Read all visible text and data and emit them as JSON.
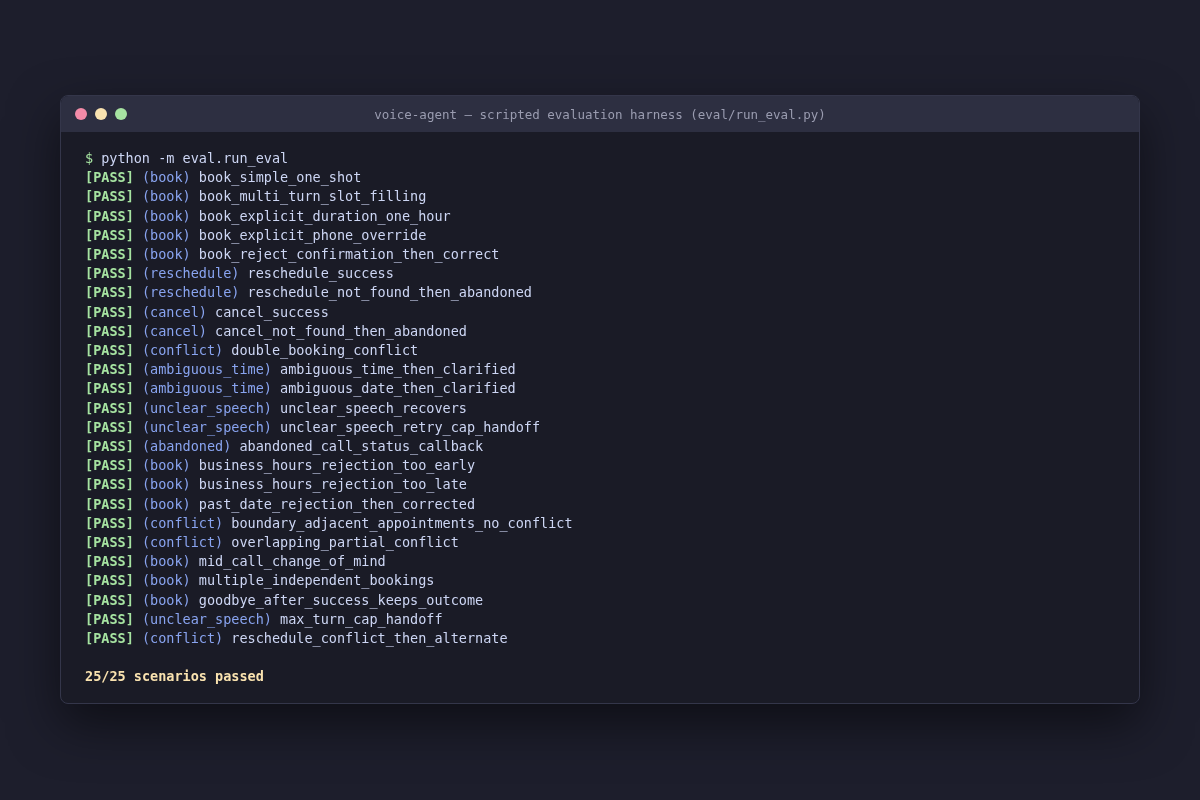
{
  "window": {
    "title": "voice-agent — scripted evaluation harness (eval/run_eval.py)"
  },
  "command": {
    "prompt": "$",
    "text": "python -m eval.run_eval"
  },
  "results": [
    {
      "status": "[PASS]",
      "category": "(book)",
      "name": "book_simple_one_shot"
    },
    {
      "status": "[PASS]",
      "category": "(book)",
      "name": "book_multi_turn_slot_filling"
    },
    {
      "status": "[PASS]",
      "category": "(book)",
      "name": "book_explicit_duration_one_hour"
    },
    {
      "status": "[PASS]",
      "category": "(book)",
      "name": "book_explicit_phone_override"
    },
    {
      "status": "[PASS]",
      "category": "(book)",
      "name": "book_reject_confirmation_then_correct"
    },
    {
      "status": "[PASS]",
      "category": "(reschedule)",
      "name": "reschedule_success"
    },
    {
      "status": "[PASS]",
      "category": "(reschedule)",
      "name": "reschedule_not_found_then_abandoned"
    },
    {
      "status": "[PASS]",
      "category": "(cancel)",
      "name": "cancel_success"
    },
    {
      "status": "[PASS]",
      "category": "(cancel)",
      "name": "cancel_not_found_then_abandoned"
    },
    {
      "status": "[PASS]",
      "category": "(conflict)",
      "name": "double_booking_conflict"
    },
    {
      "status": "[PASS]",
      "category": "(ambiguous_time)",
      "name": "ambiguous_time_then_clarified"
    },
    {
      "status": "[PASS]",
      "category": "(ambiguous_time)",
      "name": "ambiguous_date_then_clarified"
    },
    {
      "status": "[PASS]",
      "category": "(unclear_speech)",
      "name": "unclear_speech_recovers"
    },
    {
      "status": "[PASS]",
      "category": "(unclear_speech)",
      "name": "unclear_speech_retry_cap_handoff"
    },
    {
      "status": "[PASS]",
      "category": "(abandoned)",
      "name": "abandoned_call_status_callback"
    },
    {
      "status": "[PASS]",
      "category": "(book)",
      "name": "business_hours_rejection_too_early"
    },
    {
      "status": "[PASS]",
      "category": "(book)",
      "name": "business_hours_rejection_too_late"
    },
    {
      "status": "[PASS]",
      "category": "(book)",
      "name": "past_date_rejection_then_corrected"
    },
    {
      "status": "[PASS]",
      "category": "(conflict)",
      "name": "boundary_adjacent_appointments_no_conflict"
    },
    {
      "status": "[PASS]",
      "category": "(conflict)",
      "name": "overlapping_partial_conflict"
    },
    {
      "status": "[PASS]",
      "category": "(book)",
      "name": "mid_call_change_of_mind"
    },
    {
      "status": "[PASS]",
      "category": "(book)",
      "name": "multiple_independent_bookings"
    },
    {
      "status": "[PASS]",
      "category": "(book)",
      "name": "goodbye_after_success_keeps_outcome"
    },
    {
      "status": "[PASS]",
      "category": "(unclear_speech)",
      "name": "max_turn_cap_handoff"
    },
    {
      "status": "[PASS]",
      "category": "(conflict)",
      "name": "reschedule_conflict_then_alternate"
    }
  ],
  "summary": "25/25 scenarios passed"
}
